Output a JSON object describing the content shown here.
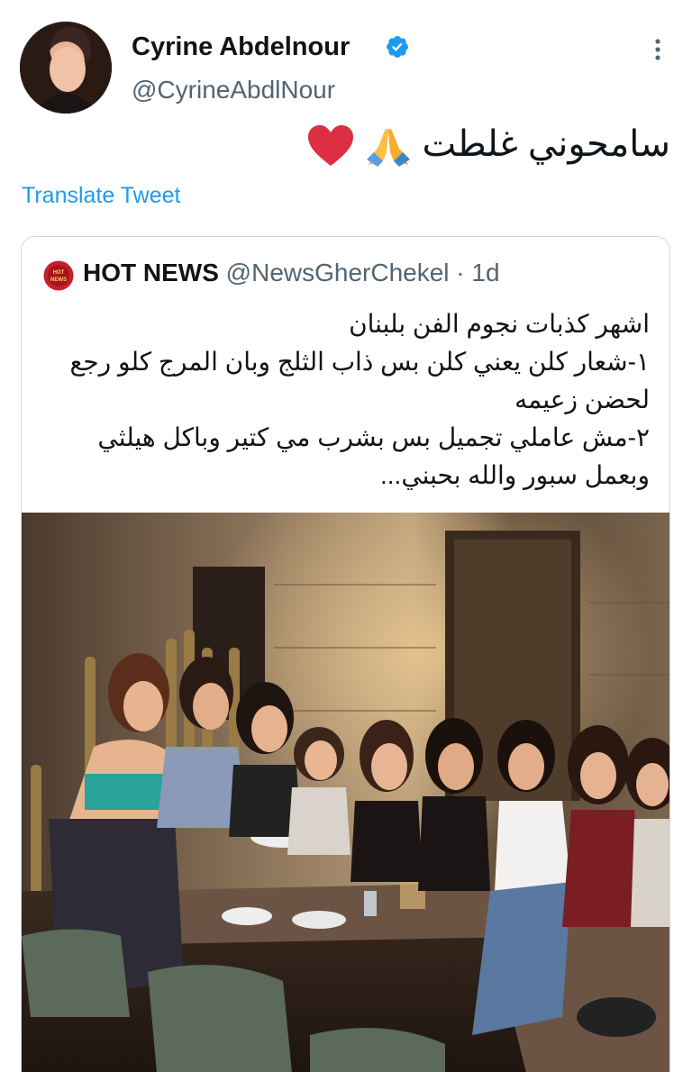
{
  "author": {
    "name": "Cyrine Abdelnour",
    "handle": "@CyrineAbdlNour"
  },
  "tweet": {
    "text": "سامحوني غلطت",
    "emojis": [
      "folded-hands",
      "red-heart"
    ],
    "translate_label": "Translate Tweet"
  },
  "quote": {
    "name": "HOT NEWS",
    "handle": "@NewsGherChekel",
    "separator": " · ",
    "time": "1d",
    "avatar_text": [
      "HOT",
      "NEWS"
    ],
    "lines": [
      "اشهر كذبات نجوم الفن بلبنان",
      "١-شعار كلن يعني كلن بس ذاب الثلج وبان المرج كلو رجع",
      "لحضن زعيمه",
      "٢-مش عاملي تجميل بس بشرب مي كتير وباكل هيلثي",
      "وبعمل سبور والله بحبني..."
    ]
  },
  "colors": {
    "link": "#1d9bf0",
    "verified": "#1d9bf0",
    "secondary_text": "#536471",
    "border": "#cfd9de"
  }
}
